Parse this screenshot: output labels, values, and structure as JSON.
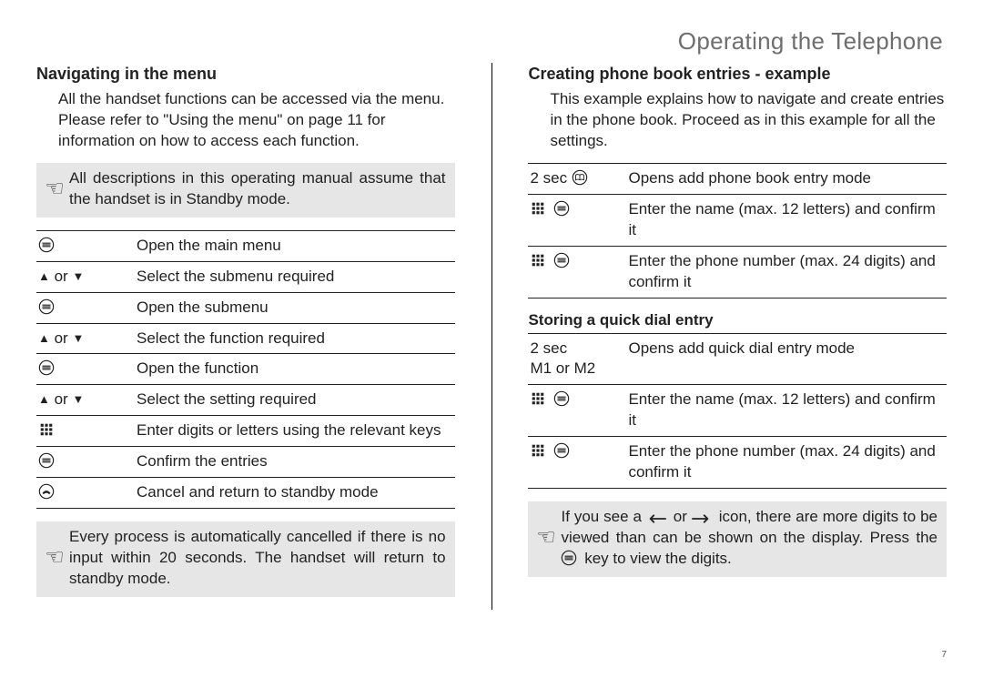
{
  "page_title": "Operating the Telephone",
  "page_number": "7",
  "left": {
    "heading": "Navigating in the menu",
    "intro": "All the handset functions can be accessed via the menu. Please refer to \"Using the menu\" on page 11 for information on how to access each function.",
    "callout1": "All descriptions in this operating manual assume that the handset is in Standby mode.",
    "steps": [
      {
        "key_kind": "menu",
        "desc": "Open the main menu"
      },
      {
        "key_kind": "updown",
        "desc": "Select the submenu required"
      },
      {
        "key_kind": "menu",
        "desc": "Open the submenu"
      },
      {
        "key_kind": "updown",
        "desc": "Select the function required"
      },
      {
        "key_kind": "menu",
        "desc": "Open the function"
      },
      {
        "key_kind": "updown",
        "desc": "Select the setting required"
      },
      {
        "key_kind": "keypad",
        "desc": "Enter digits or letters using the relevant keys"
      },
      {
        "key_kind": "menu",
        "desc": "Confirm the entries"
      },
      {
        "key_kind": "hangup",
        "desc": "Cancel and return to standby mode"
      }
    ],
    "callout2": "Every process is automatically cancelled if there is no input within 20 seconds. The handset will return to standby mode."
  },
  "right": {
    "heading": "Creating phone book entries - example",
    "intro": "This example explains how to navigate and create entries in the phone book. Proceed as in this example for all the settings.",
    "steps1": [
      {
        "key_text": "2 sec ",
        "icon": "book",
        "desc": "Opens add phone book entry mode"
      },
      {
        "icon": "keypad_menu",
        "desc": "Enter the name (max. 12 letters) and confirm it"
      },
      {
        "icon": "keypad_menu",
        "desc": "Enter the phone number (max.  24 digits) and confirm it"
      }
    ],
    "sub_heading": "Storing a quick dial entry",
    "steps2": [
      {
        "key_text": "2 sec\nM1 or M2",
        "desc": "Opens add quick dial entry mode"
      },
      {
        "icon": "keypad_menu",
        "desc": "Enter the name (max. 12 letters) and confirm it"
      },
      {
        "icon": "keypad_menu",
        "desc": "Enter the phone number (max. 24 digits) and confirm it"
      }
    ],
    "callout_parts": {
      "pre": "If you see a ",
      "mid": " or ",
      "post1": " icon, there are more digits to be viewed than can be shown on the display. Press the ",
      "post2": " key to view the digits."
    }
  }
}
